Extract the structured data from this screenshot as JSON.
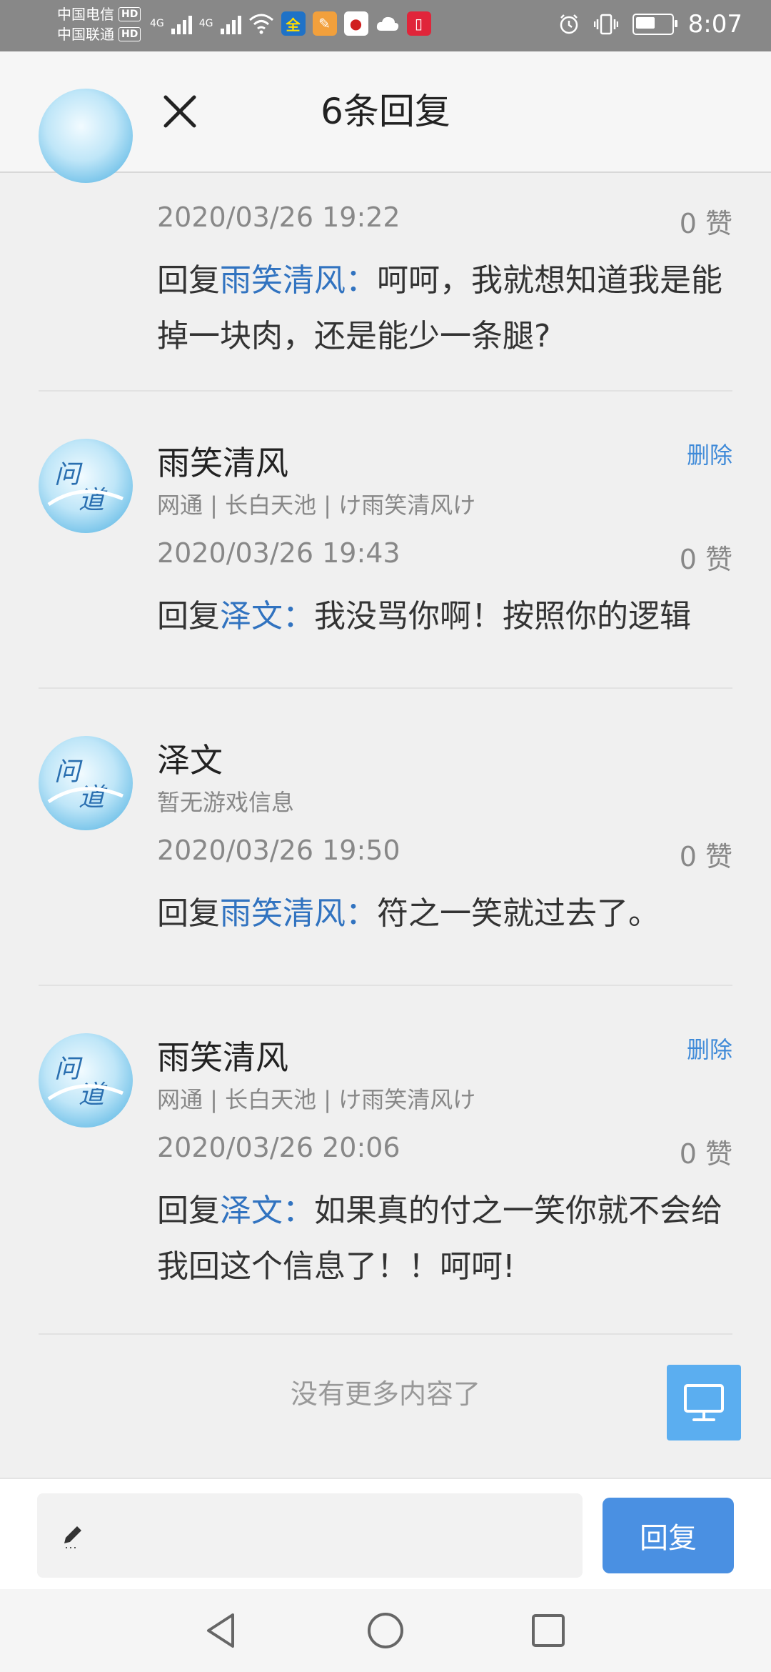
{
  "status_bar": {
    "carrier1": "中国电信",
    "carrier2": "中国联通",
    "hd": "HD",
    "network": "4G",
    "time": "8:07"
  },
  "header": {
    "title": "6条回复"
  },
  "replies": [
    {
      "time": "2020/03/26 19:22",
      "likes": "0 赞",
      "prefix": "回复",
      "target": "雨笑清风",
      "colon": "：",
      "content": "呵呵，我就想知道我是能掉一块肉，还是能少一条腿?"
    },
    {
      "name": "雨笑清风",
      "info": "网通 | 长白天池 | け雨笑清风け",
      "delete": "删除",
      "time": "2020/03/26 19:43",
      "likes": "0 赞",
      "prefix": "回复",
      "target": "泽文",
      "colon": "：",
      "content": "我没骂你啊！按照你的逻辑"
    },
    {
      "name": "泽文",
      "info": "暂无游戏信息",
      "time": "2020/03/26 19:50",
      "likes": "0 赞",
      "prefix": "回复",
      "target": "雨笑清风",
      "colon": "：",
      "content": "符之一笑就过去了。"
    },
    {
      "name": "雨笑清风",
      "info": "网通 | 长白天池 | け雨笑清风け",
      "delete": "删除",
      "time": "2020/03/26 20:06",
      "likes": "0 赞",
      "prefix": "回复",
      "target": "泽文",
      "colon": "：",
      "content": "如果真的付之一笑你就不会给我回这个信息了！！呵呵!"
    }
  ],
  "footer": {
    "no_more": "没有更多内容了"
  },
  "input_bar": {
    "reply_label": "回复"
  },
  "colors": {
    "accent": "#4a90e2",
    "link": "#3173c0",
    "float_button": "#5baef0"
  }
}
